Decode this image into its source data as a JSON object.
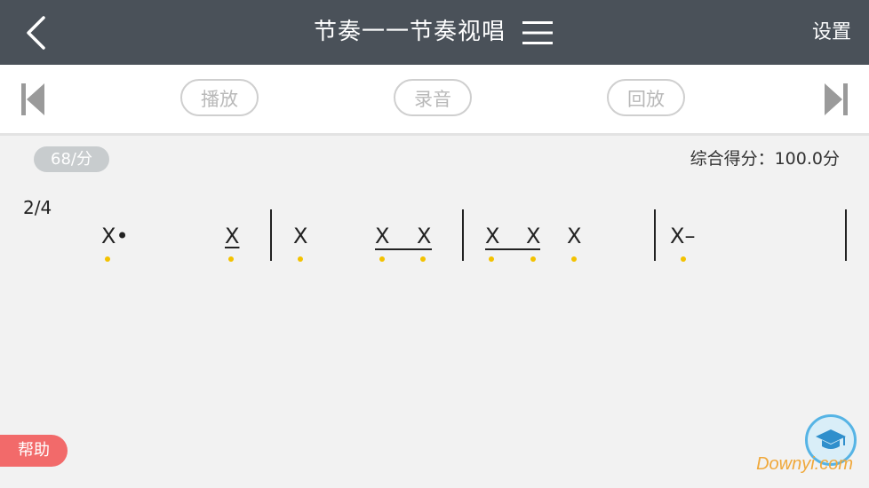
{
  "header": {
    "title": "节奏一一节奏视唱",
    "settings_label": "设置"
  },
  "toolbar": {
    "play_label": "播放",
    "record_label": "录音",
    "replay_label": "回放"
  },
  "status": {
    "tempo": "68/分",
    "score_text": "综合得分：100.0分"
  },
  "notation": {
    "time_signature": "2/4",
    "note_glyph": "X",
    "dotted_note": "X•",
    "held_note": "X–"
  },
  "help_label": "帮助",
  "watermark": "Downyi.com",
  "colors": {
    "header_bg": "#4a5159",
    "accent_yellow": "#f3c200",
    "help_red": "#f26a6a",
    "fab_blue": "#56b4e5"
  }
}
